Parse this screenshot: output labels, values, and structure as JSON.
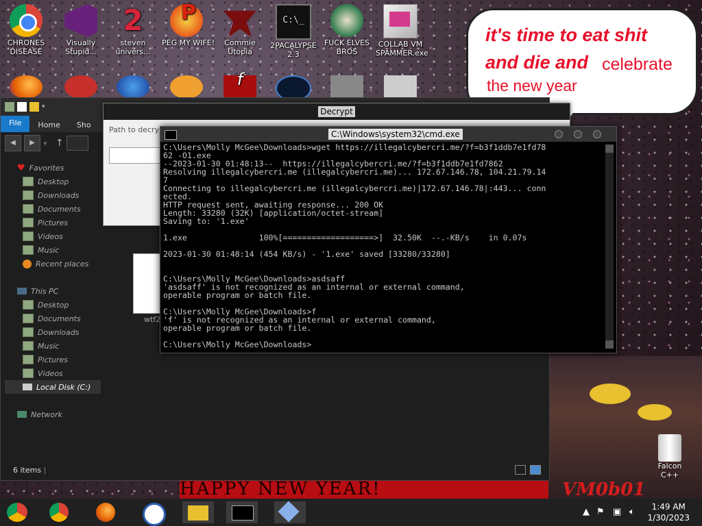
{
  "desktop_icons": [
    {
      "label": "CHRONES\nDISEASE"
    },
    {
      "label": "Visually\nStupid..."
    },
    {
      "label": "steven\nunivers..."
    },
    {
      "label": "PEG MY WIFE!"
    },
    {
      "label": "Commie\nUtopia"
    },
    {
      "label": "2PACALYPSE\n2.3"
    },
    {
      "label": "FUCK ELVES\nBROS"
    },
    {
      "label": "COLLAB VM\nSPAMMER.exe"
    }
  ],
  "bubble": {
    "line1": "it's time to eat shit",
    "line2": "and die and",
    "line2b": "celebrate",
    "line3": "the new year"
  },
  "explorer": {
    "tabs": [
      "File",
      "Home",
      "Sho"
    ],
    "sidebar_favorites_label": "Favorites",
    "favorites": [
      "Desktop",
      "Downloads",
      "Documents",
      "Pictures",
      "Videos",
      "Music",
      "Recent places"
    ],
    "this_pc_label": "This PC",
    "this_pc_items": [
      "Desktop",
      "Documents",
      "Downloads",
      "Music",
      "Pictures",
      "Videos",
      "Local Disk (C:)"
    ],
    "network_label": "Network",
    "status": "6 items",
    "file_label": "wtf2"
  },
  "decrypt": {
    "title": "Decrypt",
    "path_label": "Path to decrypt"
  },
  "cmd": {
    "title": "C:\\Windows\\system32\\cmd.exe",
    "lines": [
      "C:\\Users\\Molly McGee\\Downloads>wget https://illegalcybercri.me/?f=b3f1ddb7e1fd78",
      "62 -O1.exe",
      "--2023-01-30 01:48:13--  https://illegalcybercri.me/?f=b3f1ddb7e1fd7862",
      "Resolving illegalcybercri.me (illegalcybercri.me)... 172.67.146.78, 104.21.79.14",
      "7",
      "Connecting to illegalcybercri.me (illegalcybercri.me)|172.67.146.78|:443... conn",
      "ected.",
      "HTTP request sent, awaiting response... 200 OK",
      "Length: 33280 (32K) [application/octet-stream]",
      "Saving to: '1.exe'",
      "",
      "1.exe               100%[===================>]  32.50K  --.-KB/s    in 0.07s",
      "",
      "2023-01-30 01:48:14 (454 KB/s) - '1.exe' saved [33280/33280]",
      "",
      "",
      "C:\\Users\\Molly McGee\\Downloads>asdsaff",
      "'asdsaff' is not recognized as an internal or external command,",
      "operable program or batch file.",
      "",
      "C:\\Users\\Molly McGee\\Downloads>f",
      "'f' is not recognized as an internal or external command,",
      "operable program or batch file.",
      "",
      "C:\\Users\\Molly McGee\\Downloads>"
    ]
  },
  "recycle_label": "Falcon C++",
  "banner_text": "HAPPY NEW YEAR!",
  "vm_logo": "VM0b01",
  "clock": {
    "time": "1:49 AM",
    "date": "1/30/2023"
  },
  "colors": {
    "ribbon_active": "#1979ca",
    "bubble_text": "#e8102a",
    "banner": "#b80d12"
  }
}
